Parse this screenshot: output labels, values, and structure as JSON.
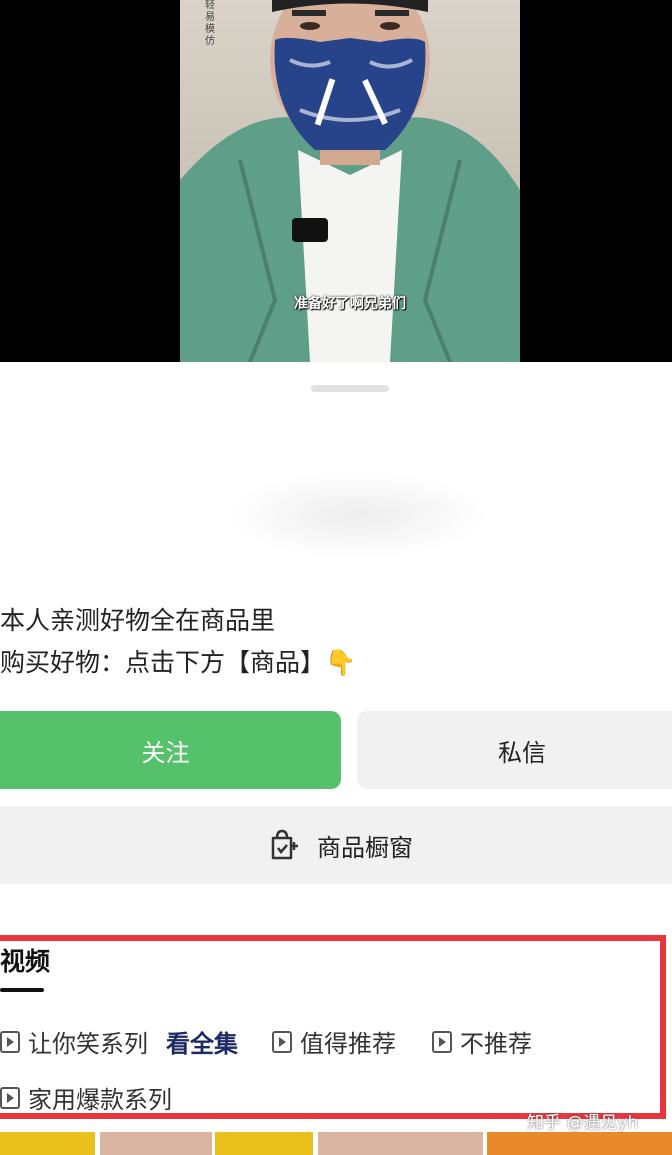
{
  "video": {
    "watermark": "轻易模仿",
    "subtitle": "准备好了啊兄弟们"
  },
  "profile": {
    "bio_line1": "本人亲测好物全在商品里",
    "bio_line2": "购买好物：点击下方【商品】👇"
  },
  "actions": {
    "follow_label": "关注",
    "message_label": "私信",
    "shop_label": "商品橱窗"
  },
  "videos": {
    "tab_label": "视频",
    "series": [
      {
        "label": "让你笑系列",
        "link": "看全集"
      },
      {
        "label": "值得推荐"
      },
      {
        "label": "不推荐"
      },
      {
        "label": "家用爆款系列"
      }
    ]
  },
  "watermark": "知乎 @遇见yh",
  "colors": {
    "follow": "#55c16a",
    "highlight_border": "#e8353e"
  }
}
